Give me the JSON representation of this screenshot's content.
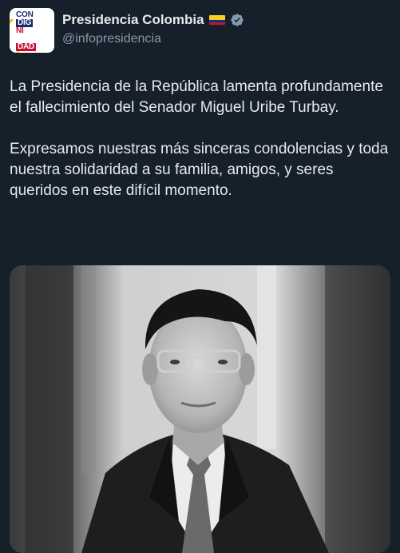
{
  "account": {
    "name": "Presidencia Colombia",
    "handle": "@infopresidencia",
    "avatar_text": [
      "CON",
      "DIG",
      "NI",
      "DAD"
    ],
    "flag_icon": "colombia-flag-icon",
    "verified_icon": "verified-badge-icon",
    "verified_color": "#829aab"
  },
  "tweet": {
    "text": "La Presidencia de la República lamenta profundamente el fallecimiento del Senador Miguel Uribe Turbay.\n\nExpresamos nuestras más sinceras condolencias y toda nuestra solidaridad a su familia, amigos, y seres queridos en este difícil momento."
  },
  "media": {
    "type": "photo",
    "style": "black-and-white"
  },
  "colors": {
    "background": "#15202b",
    "text": "#e7e9ea",
    "secondary_text": "#8b98a5"
  }
}
